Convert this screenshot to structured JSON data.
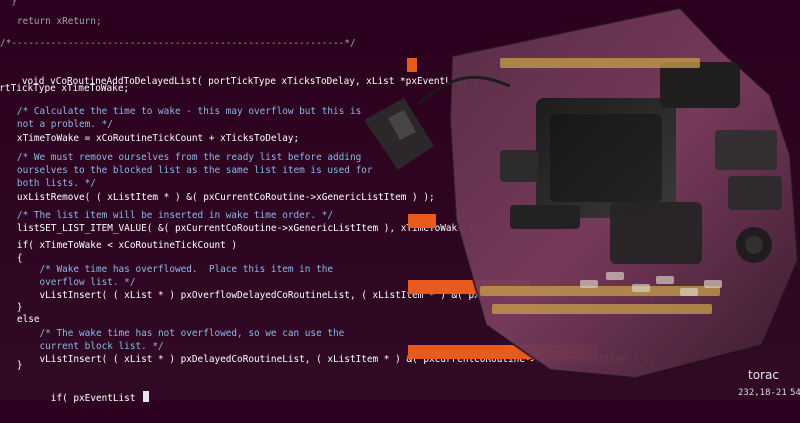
{
  "editor": {
    "lines": [
      "  }",
      "",
      "   return xReturn;",
      "}",
      "/*-----------------------------------------------------------*/",
      "",
      "void vCoRoutineAddToDelayedList( portTickType xTicksToDelay, xList *pxEventList )",
      "{",
      "portTickType xTimeToWake;",
      "",
      "   /* Calculate the time to wake - this may overflow but this is",
      "   not a problem. */",
      "   xTimeToWake = xCoRoutineTickCount + xTicksToDelay;",
      "",
      "   /* We must remove ourselves from the ready list before adding",
      "   ourselves to the blocked list as the same list item is used for",
      "   both lists. */",
      "   uxListRemove( ( xListItem * ) &( pxCurrentCoRoutine->xGenericListItem ) );",
      "",
      "   /* The list item will be inserted in wake time order. */",
      "   listSET_LIST_ITEM_VALUE( &( pxCurrentCoRoutine->xGenericListItem ), xTimeToWake );",
      "",
      "   if( xTimeToWake < xCoRoutineTickCount )",
      "   {",
      "       /* Wake time has overflowed.  Place this item in the",
      "       overflow list. */",
      "       vListInsert( ( xList * ) pxOverflowDelayedCoRoutineList, ( xListItem * ) &( pxCurrentCoRoutine->xGenericListItem ) );",
      "   }",
      "   else",
      "   {",
      "       /* The wake time has not overflowed, so we can use the",
      "       current block list. */",
      "       vListInsert( ( xList * ) pxDelayedCoRoutineList, ( xListItem * ) &( pxCurrentCoRoutine->xGenericListItem ) );",
      "   }",
      "",
      "   if( pxEventList ",
      ""
    ],
    "statusbar": {
      "position": "232,18-21",
      "percent": "54"
    }
  },
  "overlay": {
    "watermark": "torac"
  }
}
